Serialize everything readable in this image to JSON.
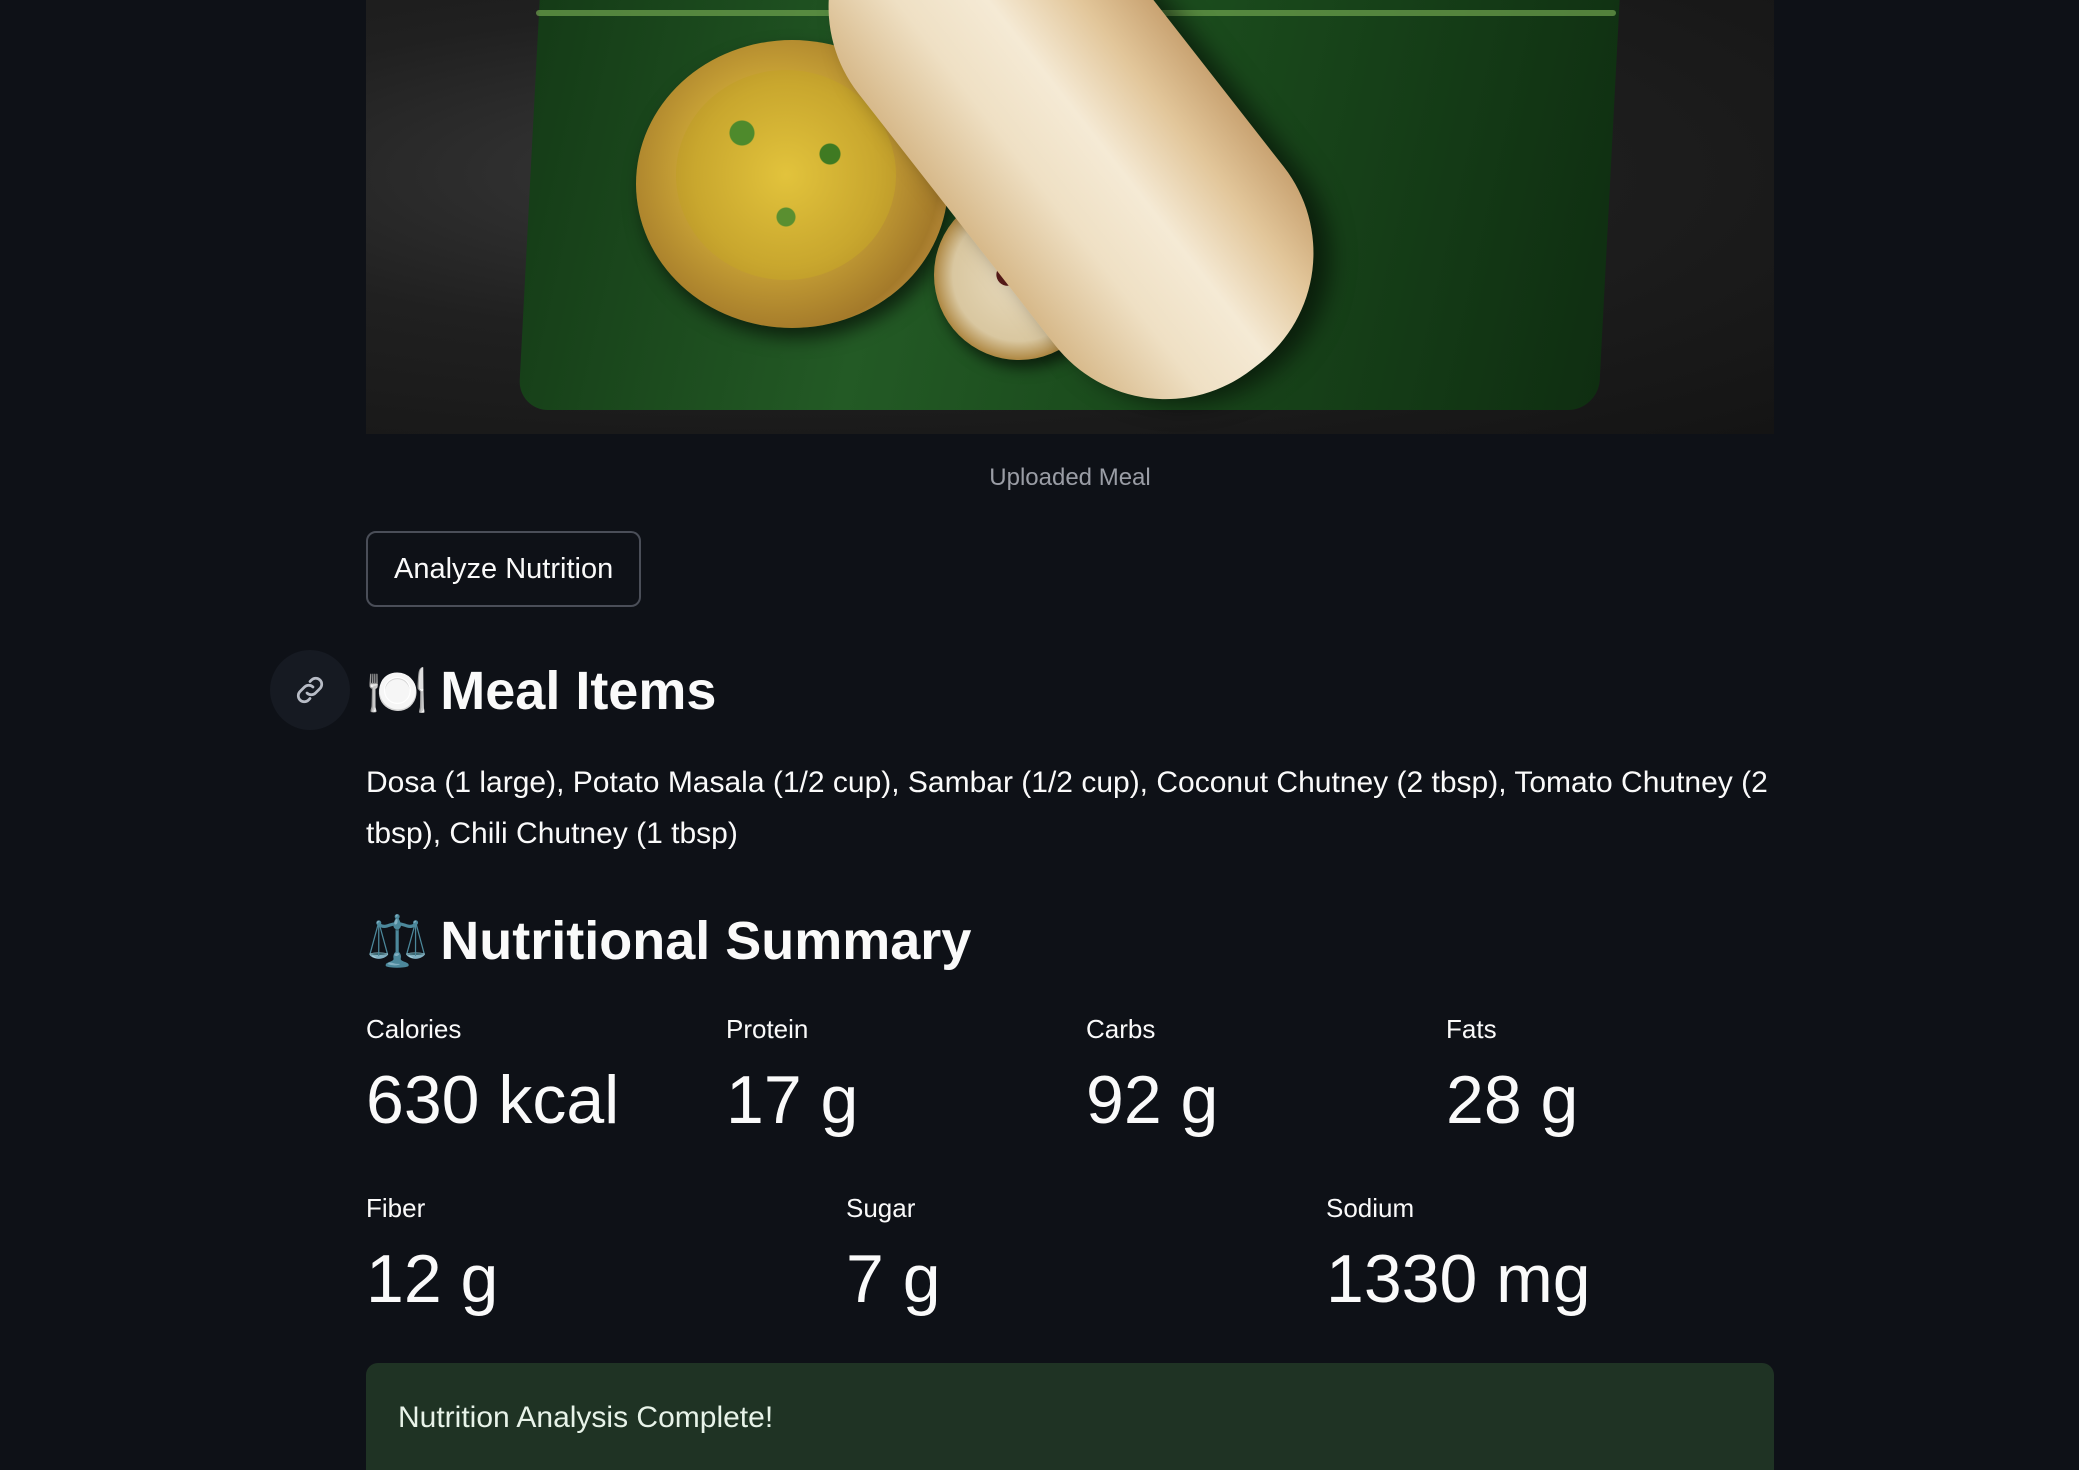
{
  "image": {
    "alt": "Uploaded Meal",
    "caption": "Uploaded Meal"
  },
  "actions": {
    "analyze_label": "Analyze Nutrition"
  },
  "meal_items": {
    "icon": "plate-cutlery-icon",
    "title": "Meal Items",
    "text": "Dosa (1 large), Potato Masala (1/2 cup), Sambar (1/2 cup), Coconut Chutney (2 tbsp), Tomato Chutney (2 tbsp), Chili Chutney (1 tbsp)"
  },
  "summary": {
    "icon": "balance-scale-icon",
    "title": "Nutritional Summary",
    "row1": [
      {
        "label": "Calories",
        "value": "630 kcal"
      },
      {
        "label": "Protein",
        "value": "17 g"
      },
      {
        "label": "Carbs",
        "value": "92 g"
      },
      {
        "label": "Fats",
        "value": "28 g"
      }
    ],
    "row2": [
      {
        "label": "Fiber",
        "value": "12 g"
      },
      {
        "label": "Sugar",
        "value": "7 g"
      },
      {
        "label": "Sodium",
        "value": "1330 mg"
      }
    ]
  },
  "status": {
    "message": "Nutrition Analysis Complete!",
    "color": "#1f3324"
  },
  "colors": {
    "background": "#0e1117",
    "text": "#fafafa",
    "muted": "#9a9da5"
  }
}
